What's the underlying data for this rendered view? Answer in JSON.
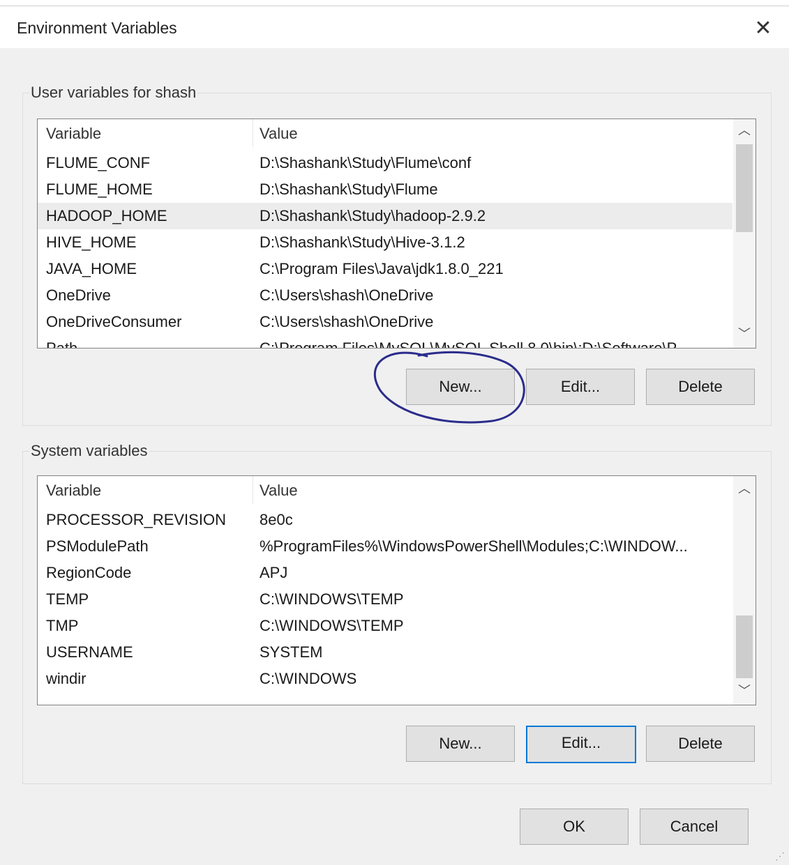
{
  "window": {
    "title": "Environment Variables",
    "close_glyph": "✕"
  },
  "user_group": {
    "label": "User variables for shash",
    "columns": {
      "variable": "Variable",
      "value": "Value"
    },
    "rows": [
      {
        "variable": "FLUME_CONF",
        "value": "D:\\Shashank\\Study\\Flume\\conf"
      },
      {
        "variable": "FLUME_HOME",
        "value": "D:\\Shashank\\Study\\Flume"
      },
      {
        "variable": "HADOOP_HOME",
        "value": "D:\\Shashank\\Study\\hadoop-2.9.2",
        "selected": true
      },
      {
        "variable": "HIVE_HOME",
        "value": "D:\\Shashank\\Study\\Hive-3.1.2"
      },
      {
        "variable": "JAVA_HOME",
        "value": "C:\\Program Files\\Java\\jdk1.8.0_221"
      },
      {
        "variable": "OneDrive",
        "value": "C:\\Users\\shash\\OneDrive"
      },
      {
        "variable": "OneDriveConsumer",
        "value": "C:\\Users\\shash\\OneDrive"
      },
      {
        "variable": "Path",
        "value": "C:\\Program Files\\MySQL\\MySQL Shell 8.0\\bin\\;D:\\Software\\P..."
      }
    ],
    "buttons": {
      "new": "New...",
      "edit": "Edit...",
      "delete": "Delete"
    }
  },
  "system_group": {
    "label": "System variables",
    "columns": {
      "variable": "Variable",
      "value": "Value"
    },
    "rows": [
      {
        "variable": "PROCESSOR_REVISION",
        "value": "8e0c"
      },
      {
        "variable": "PSModulePath",
        "value": "%ProgramFiles%\\WindowsPowerShell\\Modules;C:\\WINDOW..."
      },
      {
        "variable": "RegionCode",
        "value": "APJ"
      },
      {
        "variable": "TEMP",
        "value": "C:\\WINDOWS\\TEMP"
      },
      {
        "variable": "TMP",
        "value": "C:\\WINDOWS\\TEMP"
      },
      {
        "variable": "USERNAME",
        "value": "SYSTEM"
      },
      {
        "variable": "windir",
        "value": "C:\\WINDOWS"
      }
    ],
    "buttons": {
      "new": "New...",
      "edit": "Edit...",
      "delete": "Delete"
    }
  },
  "footer": {
    "ok": "OK",
    "cancel": "Cancel"
  },
  "icons": {
    "scroll_up": "chevron-up-icon",
    "scroll_down": "chevron-down-icon",
    "close": "close-icon"
  },
  "colors": {
    "annotation": "#2b2c8c",
    "focus_border": "#0078d7",
    "selection": "#ececec"
  }
}
